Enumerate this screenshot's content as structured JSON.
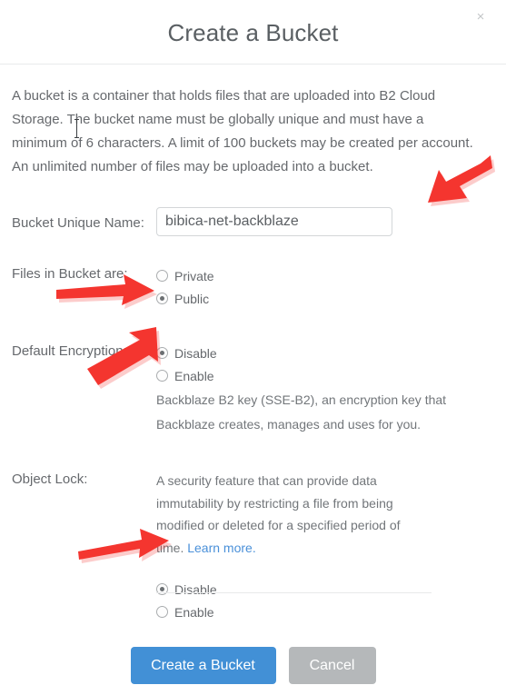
{
  "dialog": {
    "title": "Create a Bucket",
    "close_label": "×",
    "intro": "A bucket is a container that holds files that are uploaded into B2 Cloud Storage. The bucket name must be globally unique and must have a minimum of 6 characters. A limit of 100 buckets may be created per account. An unlimited number of files may be uploaded into a bucket."
  },
  "bucket_name": {
    "label": "Bucket Unique Name:",
    "value": "bibica-net-backblaze",
    "placeholder": ""
  },
  "files_in_bucket": {
    "label": "Files in Bucket are:",
    "options": [
      {
        "label": "Private",
        "selected": false
      },
      {
        "label": "Public",
        "selected": true
      }
    ]
  },
  "default_encryption": {
    "label": "Default Encryption:",
    "options": [
      {
        "label": "Disable",
        "selected": true
      },
      {
        "label": "Enable",
        "selected": false
      }
    ],
    "help_line_1": "Backblaze B2 key (SSE-B2), an encryption key that",
    "help_line_2": "Backblaze creates, manages and uses for you."
  },
  "object_lock": {
    "label": "Object Lock:",
    "description": "A security feature that can provide data immutability by restricting a file from being modified or deleted for a specified period of time. ",
    "link_label": "Learn more.",
    "options": [
      {
        "label": "Disable",
        "selected": true
      },
      {
        "label": "Enable",
        "selected": false
      }
    ]
  },
  "footer": {
    "primary_label": "Create a Bucket",
    "secondary_label": "Cancel"
  },
  "colors": {
    "primary_button": "#4290d6",
    "secondary_button": "#b5b8ba",
    "link": "#4a90d9",
    "annotation_arrow": "#f4352f",
    "text": "#66696d"
  },
  "annotations": {
    "arrows": [
      {
        "name": "arrow-to-bucket-name-input",
        "direction": "left-down"
      },
      {
        "name": "arrow-to-public-option",
        "direction": "right"
      },
      {
        "name": "arrow-to-encryption-disable-option",
        "direction": "up-right"
      },
      {
        "name": "arrow-to-objectlock-disable-option",
        "direction": "right"
      }
    ]
  }
}
